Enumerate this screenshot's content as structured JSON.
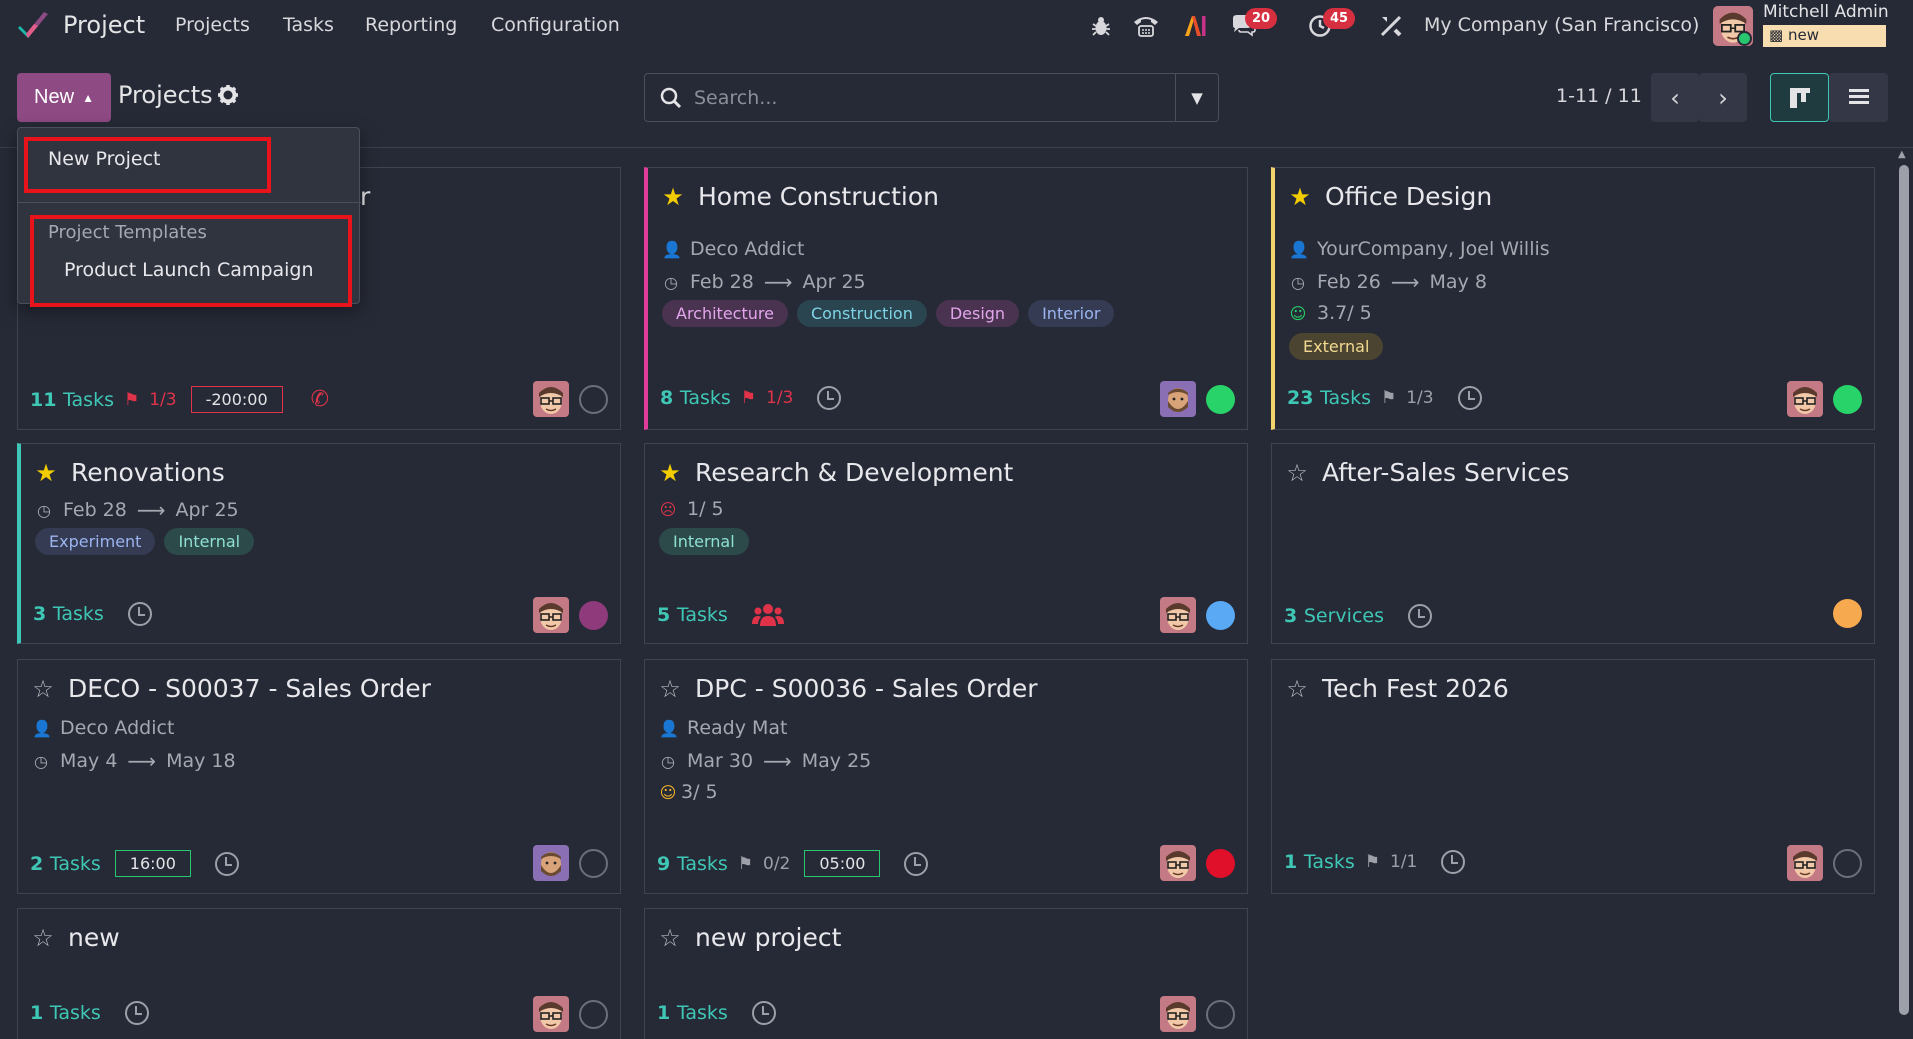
{
  "navbar": {
    "app_name": "Project",
    "menus": [
      "Projects",
      "Tasks",
      "Reporting",
      "Configuration"
    ],
    "messages_badge": "20",
    "activities_badge": "45",
    "company": "My Company (San Francisco)",
    "user_name": "Mitchell Admin",
    "database": "new"
  },
  "control": {
    "new_label": "New",
    "breadcrumb": "Projects",
    "search_placeholder": "Search...",
    "pager": "1-11 / 11"
  },
  "dropdown": {
    "new_project": "New Project",
    "section": "Project Templates",
    "template": "Product Launch Campaign",
    "partial_title_behind": "r"
  },
  "cards": [
    {
      "title": "",
      "tasks": "11",
      "tasks_label": "Tasks",
      "milestones": "1/3",
      "time": "-200:00"
    },
    {
      "title": "Home Construction",
      "customer": "Deco Addict",
      "start": "Feb 28",
      "end": "Apr 25",
      "tags": [
        "Architecture",
        "Construction",
        "Design",
        "Interior"
      ],
      "tasks": "8",
      "tasks_label": "Tasks",
      "milestones": "1/3"
    },
    {
      "title": "Office Design",
      "customer": "YourCompany, Joel Willis",
      "start": "Feb 26",
      "end": "May 8",
      "rating": "3.7/ 5",
      "tags": [
        "External"
      ],
      "tasks": "23",
      "tasks_label": "Tasks",
      "milestones": "1/3"
    },
    {
      "title": "Renovations",
      "start": "Feb 28",
      "end": "Apr 25",
      "tags": [
        "Experiment",
        "Internal"
      ],
      "tasks": "3",
      "tasks_label": "Tasks"
    },
    {
      "title": "Research & Development",
      "rating": "1/ 5",
      "tags": [
        "Internal"
      ],
      "tasks": "5",
      "tasks_label": "Tasks"
    },
    {
      "title": "After-Sales Services",
      "tasks": "3",
      "tasks_label": "Services"
    },
    {
      "title": "DECO - S00037 - Sales Order",
      "customer": "Deco Addict",
      "start": "May 4",
      "end": "May 18",
      "tasks": "2",
      "tasks_label": "Tasks",
      "time": "16:00"
    },
    {
      "title": "DPC - S00036 - Sales Order",
      "customer": "Ready Mat",
      "start": "Mar 30",
      "end": "May 25",
      "rating": "3/ 5",
      "tasks": "9",
      "tasks_label": "Tasks",
      "milestones": "0/2",
      "time": "05:00"
    },
    {
      "title": "Tech Fest 2026",
      "tasks": "1",
      "tasks_label": "Tasks",
      "milestones": "1/1"
    },
    {
      "title": "new",
      "tasks": "1",
      "tasks_label": "Tasks"
    },
    {
      "title": "new project",
      "tasks": "1",
      "tasks_label": "Tasks"
    }
  ],
  "colors": {
    "accent": "#8e4a83",
    "teal": "#3fc7b6",
    "star": "#f3cc00",
    "highlight": "#e8131b",
    "danger": "#e0334a"
  }
}
